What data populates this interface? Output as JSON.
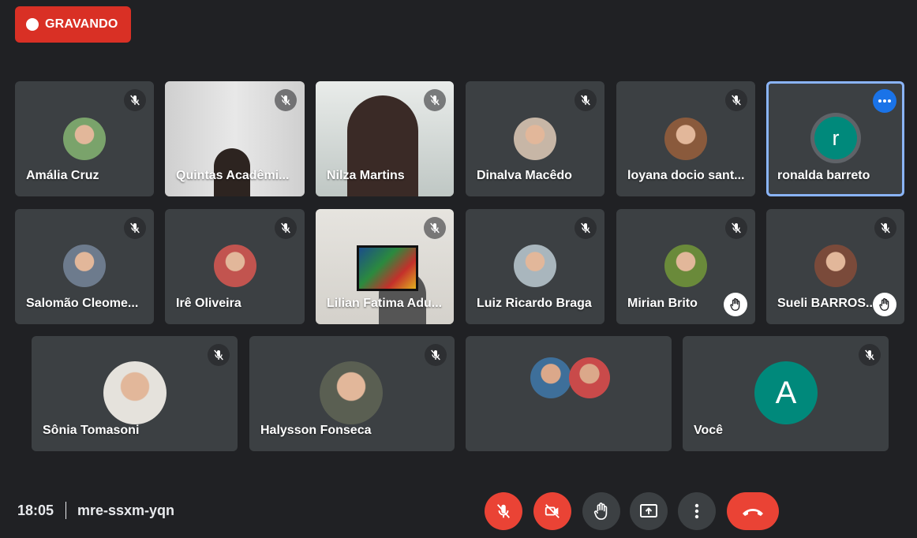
{
  "recording": {
    "label": "GRAVANDO",
    "color": "#d93025"
  },
  "participants": [
    {
      "name": "Amália Cruz",
      "avatar_color": "#7aa36b"
    },
    {
      "name": "Quintas Acadêmi..."
    },
    {
      "name": "Nilza Martins"
    },
    {
      "name": "Dinalva Macêdo",
      "avatar_color": "#c7b6a6"
    },
    {
      "name": "loyana docio sant...",
      "avatar_color": "#8a5a3c"
    },
    {
      "name": "ronalda barreto",
      "avatar_letter": "r",
      "avatar_color": "#00897b",
      "active": true
    },
    {
      "name": "Salomão Cleome...",
      "avatar_color": "#6d7b8d"
    },
    {
      "name": "Irê Oliveira",
      "avatar_color": "#c2544f"
    },
    {
      "name": "Lilian Fatima Adu..."
    },
    {
      "name": "Luiz Ricardo Braga",
      "avatar_color": "#a9b6bd"
    },
    {
      "name": "Mirian Brito",
      "avatar_color": "#6a8a3a",
      "hand_raised": true
    },
    {
      "name": "Sueli BARROS...",
      "avatar_color": "#7a4a3a",
      "hand_raised": true
    },
    {
      "name": "Sônia Tomasoni",
      "avatar_color": "#e5e2dc"
    },
    {
      "name": "Halysson Fonseca",
      "avatar_color": "#5a5f52"
    },
    {
      "name": ""
    },
    {
      "name": "Você",
      "avatar_letter": "A",
      "avatar_color": "#00897b"
    }
  ],
  "footer": {
    "time": "18:05",
    "meeting_code": "mre-ssxm-yqn"
  },
  "controls": [
    {
      "name": "mic-toggle-button",
      "icon": "mic-off-icon",
      "state": "off"
    },
    {
      "name": "camera-toggle-button",
      "icon": "camera-off-icon",
      "state": "off"
    },
    {
      "name": "raise-hand-button",
      "icon": "hand-icon"
    },
    {
      "name": "present-button",
      "icon": "present-screen-icon"
    },
    {
      "name": "more-options-button",
      "icon": "more-vertical-icon"
    },
    {
      "name": "leave-call-button",
      "icon": "hang-up-icon"
    }
  ],
  "colors": {
    "background": "#202124",
    "tile": "#3c4043",
    "active_border": "#8ab4f8",
    "danger": "#ea4335"
  }
}
